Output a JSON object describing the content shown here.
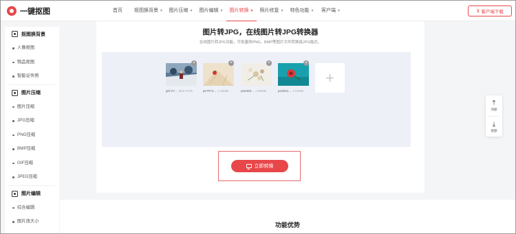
{
  "header": {
    "logo_text": "一键抠图",
    "nav": [
      {
        "label": "首页",
        "has_caret": false,
        "active": false
      },
      {
        "label": "抠图换背景",
        "has_caret": true,
        "active": false
      },
      {
        "label": "图片压缩",
        "has_caret": true,
        "active": false
      },
      {
        "label": "图片编辑",
        "has_caret": true,
        "active": false
      },
      {
        "label": "图片转换",
        "has_caret": true,
        "active": true
      },
      {
        "label": "照片修复",
        "has_caret": true,
        "active": false
      },
      {
        "label": "特色功能",
        "has_caret": true,
        "active": false
      },
      {
        "label": "客户端",
        "has_caret": true,
        "active": false
      }
    ],
    "download_label": "客户端下载"
  },
  "sidebar": {
    "sections": [
      {
        "title": "抠图换背景",
        "items": [
          "人像抠图",
          "物品抠图",
          "智能证件照"
        ]
      },
      {
        "title": "图片压缩",
        "items": [
          "图片压缩",
          "JPG压缩",
          "PNG压缩",
          "BMP压缩",
          "GIF压缩",
          "JPEG压缩"
        ]
      },
      {
        "title": "图片编辑",
        "items": [
          "综合编辑",
          "图片改大小"
        ]
      }
    ]
  },
  "main": {
    "title": "图片转JPG，在线图片转JPG转换器",
    "subtitle": "在线图片转JPG功能，可批量将PNG、BMP等图片文件转换成JPG格式。",
    "files": [
      {
        "name": "girl-27...",
        "size": "853.37KB"
      },
      {
        "name": "pe7074...",
        "size": "1.05MB"
      },
      {
        "name": "pe5450...",
        "size": "1.58MB"
      },
      {
        "name": "pe3041...",
        "size": "1.04MB"
      }
    ],
    "add_symbol": "+",
    "convert_label": "立即转换",
    "close_symbol": "×"
  },
  "section": {
    "title": "功能优势"
  },
  "float_widget": {
    "top_label": "顶部",
    "bottom_label": "底部"
  },
  "colors": {
    "accent": "#e8474a",
    "upload_bg": "#eef0f8"
  }
}
